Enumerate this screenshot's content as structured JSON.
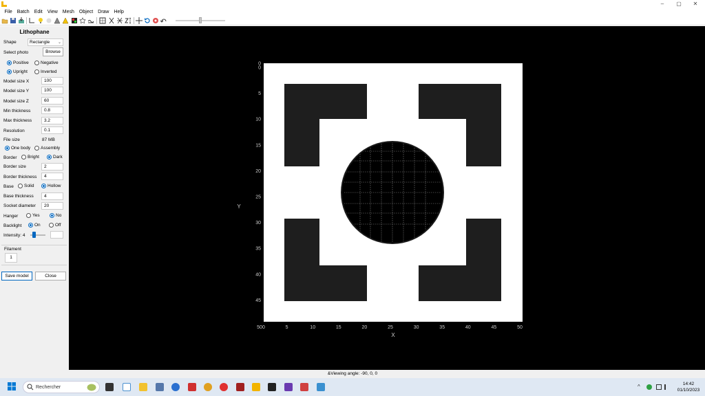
{
  "window": {
    "minimize": "–",
    "maximize": "▢",
    "close": "✕"
  },
  "menu": [
    "File",
    "Batch",
    "Edit",
    "View",
    "Mesh",
    "Object",
    "Draw",
    "Help"
  ],
  "panel": {
    "title": "Lithophane",
    "shape_label": "Shape",
    "shape_value": "Rectangle",
    "select_photo_label": "Select photo",
    "browse_label": "Browse",
    "positive": "Positive",
    "negative": "Negative",
    "upright": "Upright",
    "inverted": "Inverted",
    "model_x_label": "Model size X",
    "model_x": "100",
    "model_y_label": "Model size Y",
    "model_y": "100",
    "model_z_label": "Model size Z",
    "model_z": "60",
    "min_thick_label": "Min thickness",
    "min_thick": "0.8",
    "max_thick_label": "Max thickness",
    "max_thick": "3.2",
    "resolution_label": "Resolution",
    "resolution": "0.1",
    "file_size_label": "File size",
    "file_size": "87 MB",
    "one_body": "One body",
    "assembly": "Assembly",
    "border_label": "Border",
    "bright": "Bright",
    "dark": "Dark",
    "border_size_label": "Border size",
    "border_size": "2",
    "border_thick_label": "Border thickness",
    "border_thick": "4",
    "base_label": "Base",
    "solid": "Solid",
    "hollow": "Hollow",
    "base_thick_label": "Base thickness",
    "base_thick": "4",
    "socket_label": "Socket diameter",
    "socket": "20",
    "hanger_label": "Hanger",
    "yes": "Yes",
    "no": "No",
    "backlight_label": "Backlight",
    "on": "On",
    "off": "Off",
    "intensity_label": "Intensity: 4",
    "intensity_value": 4,
    "filament_label": "Filament",
    "filament_value": "1",
    "save_label": "Save model",
    "close_label": "Close"
  },
  "viewport": {
    "y_axis_label": "Y",
    "x_axis_label": "X",
    "x_ticks": [
      "500",
      "5",
      "10",
      "15",
      "20",
      "25",
      "30",
      "35",
      "40",
      "45",
      "50"
    ],
    "y_ticks": [
      "0",
      "0",
      "5",
      "10",
      "15",
      "20",
      "25",
      "30",
      "35",
      "40",
      "45"
    ]
  },
  "status": {
    "text": "&Viewing angle: -90, 0, 0"
  },
  "taskbar": {
    "search_placeholder": "Rechercher",
    "time": "14:42",
    "date": "01/10/2023"
  },
  "colors": {
    "accent": "#0067c0",
    "viewport_bg": "#000000",
    "panel_bg": "#f0f0f0",
    "plate": "#ffffff",
    "dark_shape": "#1e1e1e"
  }
}
